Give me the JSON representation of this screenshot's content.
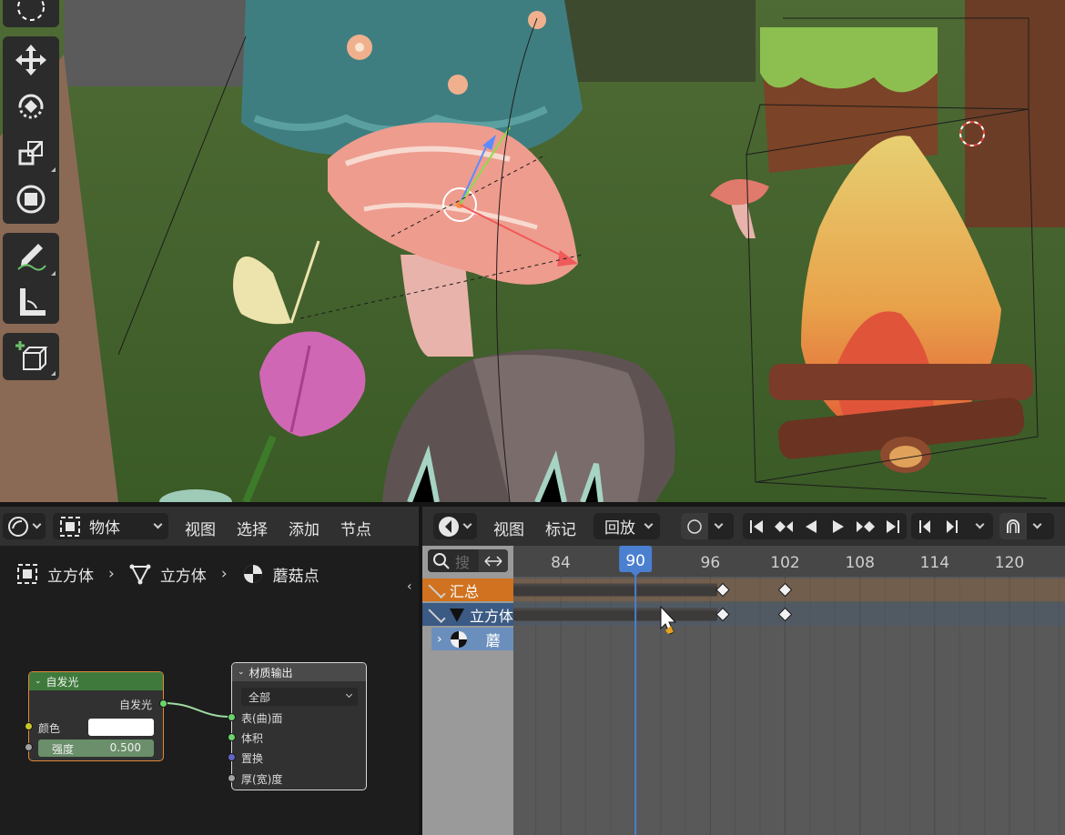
{
  "node_editor": {
    "header": {
      "mode_label": "物体",
      "menus": [
        "视图",
        "选择",
        "添加",
        "节点"
      ]
    },
    "breadcrumb": [
      "立方体",
      "立方体",
      "蘑菇点"
    ],
    "nodes": {
      "emission": {
        "title": "自发光",
        "output_label": "自发光",
        "color_label": "颜色",
        "strength_label": "强度",
        "strength_value": "0.500",
        "color_value": "#ffffff"
      },
      "material_output": {
        "title": "材质输出",
        "target_value": "全部",
        "inputs": [
          "表(曲)面",
          "体积",
          "置换",
          "厚(宽)度"
        ]
      }
    }
  },
  "dope_sheet": {
    "header": {
      "menus": [
        "视图",
        "标记"
      ],
      "playback_label": "回放"
    },
    "search_placeholder": "搜",
    "current_frame": "90",
    "frame_ticks": [
      "84",
      "90",
      "96",
      "102",
      "108",
      "114",
      "120"
    ],
    "channels": [
      {
        "label": "汇总",
        "type": "summary"
      },
      {
        "label": "立方体",
        "type": "object"
      },
      {
        "label": "蘑",
        "type": "material"
      }
    ],
    "keyframe_frames": [
      97,
      102
    ],
    "colors": {
      "summary": "#d0721f",
      "object": "#3b5a84",
      "material": "#6a8fbc",
      "playhead": "#4b7fd0"
    }
  }
}
